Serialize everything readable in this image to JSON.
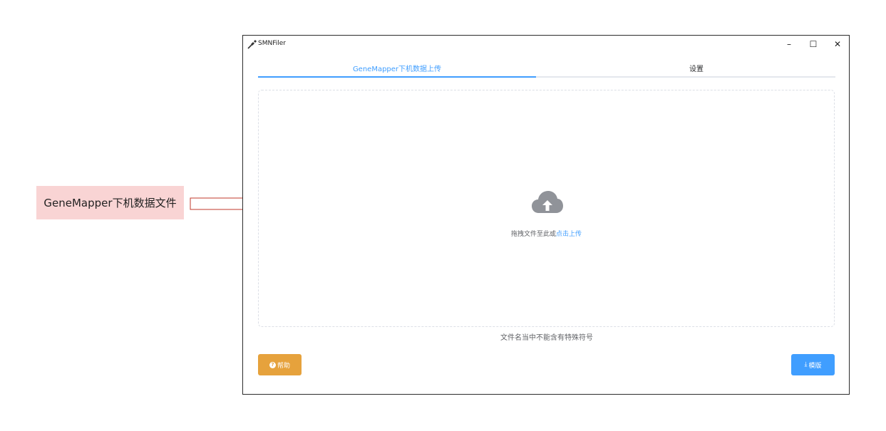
{
  "annotation": {
    "label": "GeneMapper下机数据文件"
  },
  "window": {
    "title": "SMNFiler",
    "controls": {
      "minimize": "–",
      "maximize": "☐",
      "close": "✕"
    }
  },
  "tabs": [
    {
      "label": "GeneMapper下机数据上传",
      "active": true
    },
    {
      "label": "设置",
      "active": false
    }
  ],
  "upload": {
    "icon": "cloud-upload-icon",
    "text_prefix": "拖拽文件至此或",
    "text_link": "点击上传"
  },
  "tip": "文件名当中不能含有特殊符号",
  "buttons": {
    "help": {
      "icon": "question-circle-icon",
      "label": "帮助"
    },
    "template": {
      "icon": "download-icon",
      "label": "模版",
      "icon_glyph": "⤓"
    }
  },
  "colors": {
    "primary": "#409eff",
    "warning": "#e6a23c",
    "callout_bg": "#f9d4d4",
    "arrow_stroke": "#c0392b"
  }
}
